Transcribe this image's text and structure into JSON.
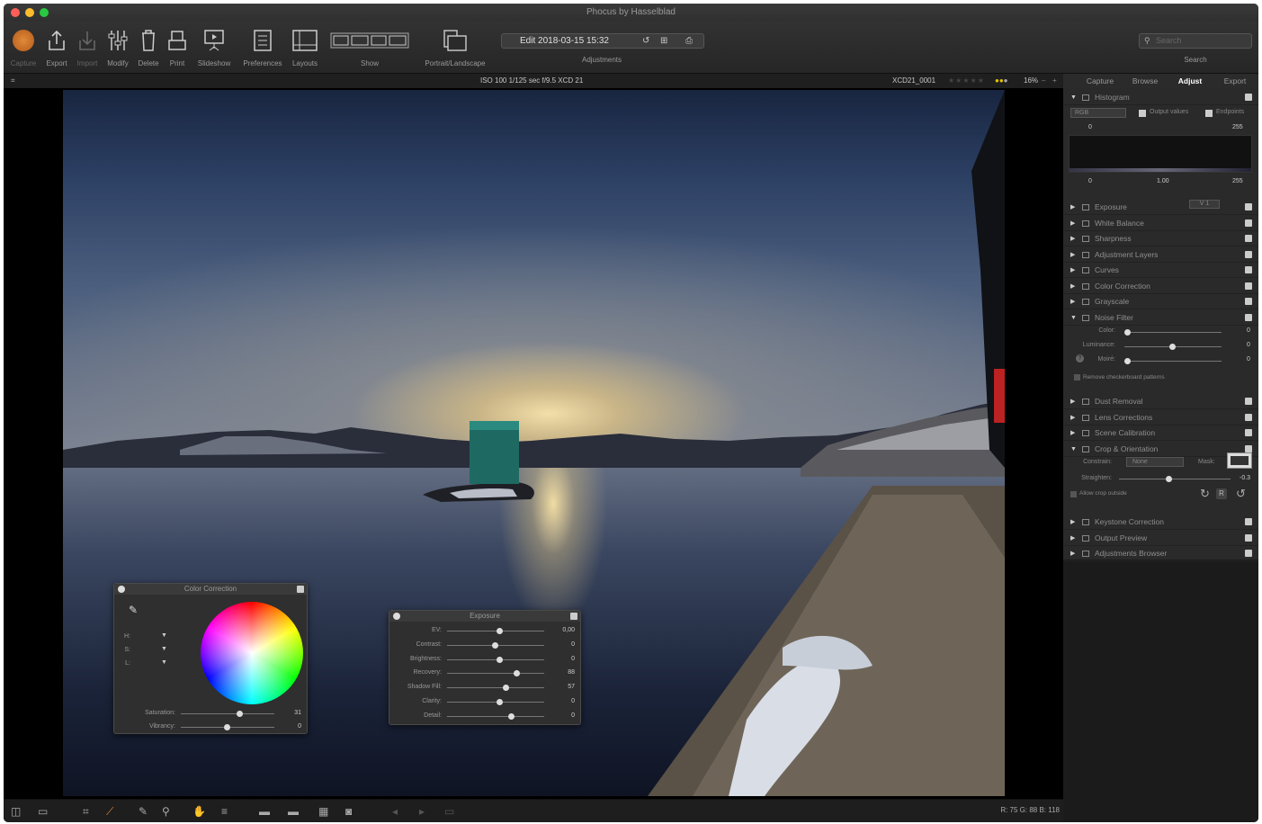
{
  "window": {
    "title": "Phocus by Hasselblad"
  },
  "toolbar": {
    "capture": "Capture",
    "export": "Export",
    "import": "Import",
    "modify": "Modify",
    "delete": "Delete",
    "print": "Print",
    "slideshow": "Slideshow",
    "preferences": "Preferences",
    "layouts": "Layouts",
    "show": "Show",
    "portrait": "Portrait/Landscape",
    "adjustments": "Adjustments",
    "search": "Search",
    "edit_value": "Edit 2018-03-15 15:32",
    "search_placeholder": "Search"
  },
  "infobar": {
    "exif": "ISO 100  1/125 sec  f/9.5  XCD 21",
    "filename": "XCD21_0001",
    "zoom": "16%"
  },
  "sidebar": {
    "tabs": [
      "Capture",
      "Browse",
      "Adjust",
      "Export"
    ],
    "histogram": {
      "title": "Histogram",
      "channel": "RGB",
      "output_values": "Output values",
      "endpoints": "Endpoints",
      "in_low": "0",
      "in_high": "255",
      "out_low": "0",
      "gamma": "1.00",
      "out_high": "255"
    },
    "tools": [
      "Exposure",
      "White Balance",
      "Sharpness",
      "Adjustment Layers",
      "Curves",
      "Color Correction",
      "Grayscale",
      "Noise Filter"
    ],
    "exposure_version": "V 1",
    "noise": {
      "color": "Color:",
      "luminance": "Luminance:",
      "moire": "Moiré:",
      "color_val": "0",
      "lum_val": "0",
      "moire_val": "0",
      "checker": "Remove checkerboard patterns"
    },
    "tools2": [
      "Dust Removal",
      "Lens Corrections",
      "Scene Calibration",
      "Crop & Orientation"
    ],
    "crop": {
      "constrain": "Constrain:",
      "constrain_val": "None",
      "mask": "Mask:",
      "straighten": "Straighten:",
      "straighten_val": "-0.3",
      "allow": "Allow crop outside"
    },
    "tools3": [
      "Keystone Correction",
      "Output Preview",
      "Adjustments Browser"
    ]
  },
  "color_panel": {
    "title": "Color Correction",
    "h": "H:",
    "s": "S:",
    "l": "L:",
    "saturation": "Saturation:",
    "vibrancy": "Vibrancy:",
    "sat_val": "31",
    "vib_val": "0"
  },
  "exposure_panel": {
    "title": "Exposure",
    "rows": [
      {
        "label": "EV:",
        "value": "0,00"
      },
      {
        "label": "Contrast:",
        "value": "0"
      },
      {
        "label": "Brightness:",
        "value": "0"
      },
      {
        "label": "Recovery:",
        "value": "88"
      },
      {
        "label": "Shadow Fill:",
        "value": "57"
      },
      {
        "label": "Clarity:",
        "value": "0"
      },
      {
        "label": "Detail:",
        "value": "0"
      }
    ]
  },
  "statusbar": {
    "rgb": "R:  75  G:  88  B:  118"
  },
  "colors": {
    "accent": "#e08a3a",
    "panel": "#2a2a2a"
  }
}
